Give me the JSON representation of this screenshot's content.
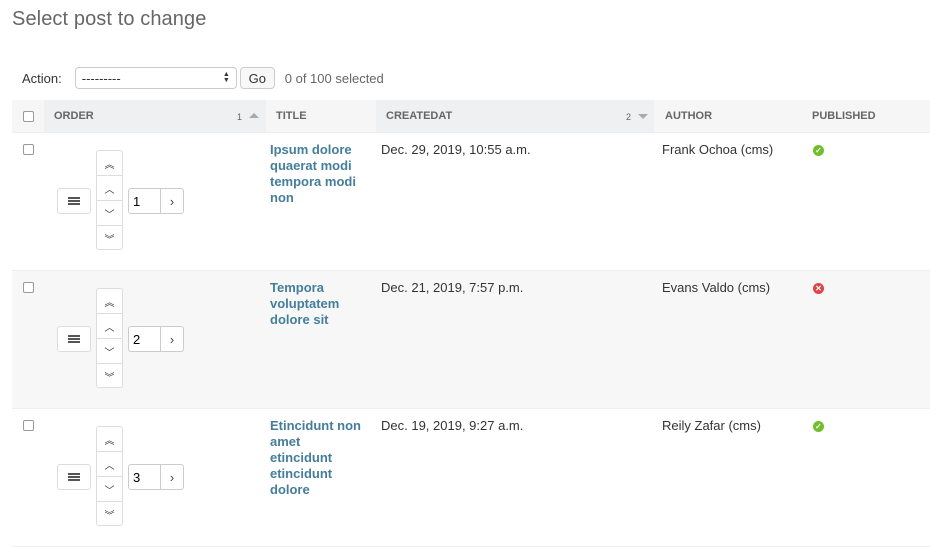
{
  "page_title": "Select post to change",
  "actions": {
    "label": "Action:",
    "selected_option": "---------",
    "go_label": "Go",
    "selected_count": "0 of 100 selected"
  },
  "columns": {
    "order": {
      "label": "ORDER",
      "sort_priority": "1",
      "sort_direction": "ascending"
    },
    "title": {
      "label": "TITLE"
    },
    "createdat": {
      "label": "CREATEDAT",
      "sort_priority": "2",
      "sort_direction": "descending"
    },
    "author": {
      "label": "AUTHOR"
    },
    "published": {
      "label": "PUBLISHED"
    }
  },
  "rows": [
    {
      "order": "1",
      "title_lines": [
        "Ipsum dolore",
        "quaerat modi",
        "tempora modi",
        "non"
      ],
      "createdat": "Dec. 29, 2019, 10:55 a.m.",
      "author": "Frank Ochoa (cms)",
      "published": true
    },
    {
      "order": "2",
      "title_lines": [
        "Tempora",
        "voluptatem",
        "dolore sit"
      ],
      "createdat": "Dec. 21, 2019, 7:57 p.m.",
      "author": "Evans Valdo (cms)",
      "published": false
    },
    {
      "order": "3",
      "title_lines": [
        "Etincidunt non",
        "amet",
        "etincidunt",
        "etincidunt",
        "dolore"
      ],
      "createdat": "Dec. 19, 2019, 9:27 a.m.",
      "author": "Reily Zafar (cms)",
      "published": true
    }
  ],
  "icons": {
    "drag_handle": "drag-handle-icon",
    "move_top": "double-chevron-up-icon",
    "move_up": "chevron-up-icon",
    "move_down": "chevron-down-icon",
    "move_bottom": "double-chevron-down-icon",
    "go_to_position": "chevron-right-icon",
    "published_true": "check-circle-icon",
    "published_false": "x-circle-icon"
  },
  "colors": {
    "link": "#447e9b",
    "published_true": "#70bf2b",
    "published_false": "#dd4646",
    "header_bg": "#f6f6f6",
    "alt_row_bg": "#f7f7f7"
  }
}
